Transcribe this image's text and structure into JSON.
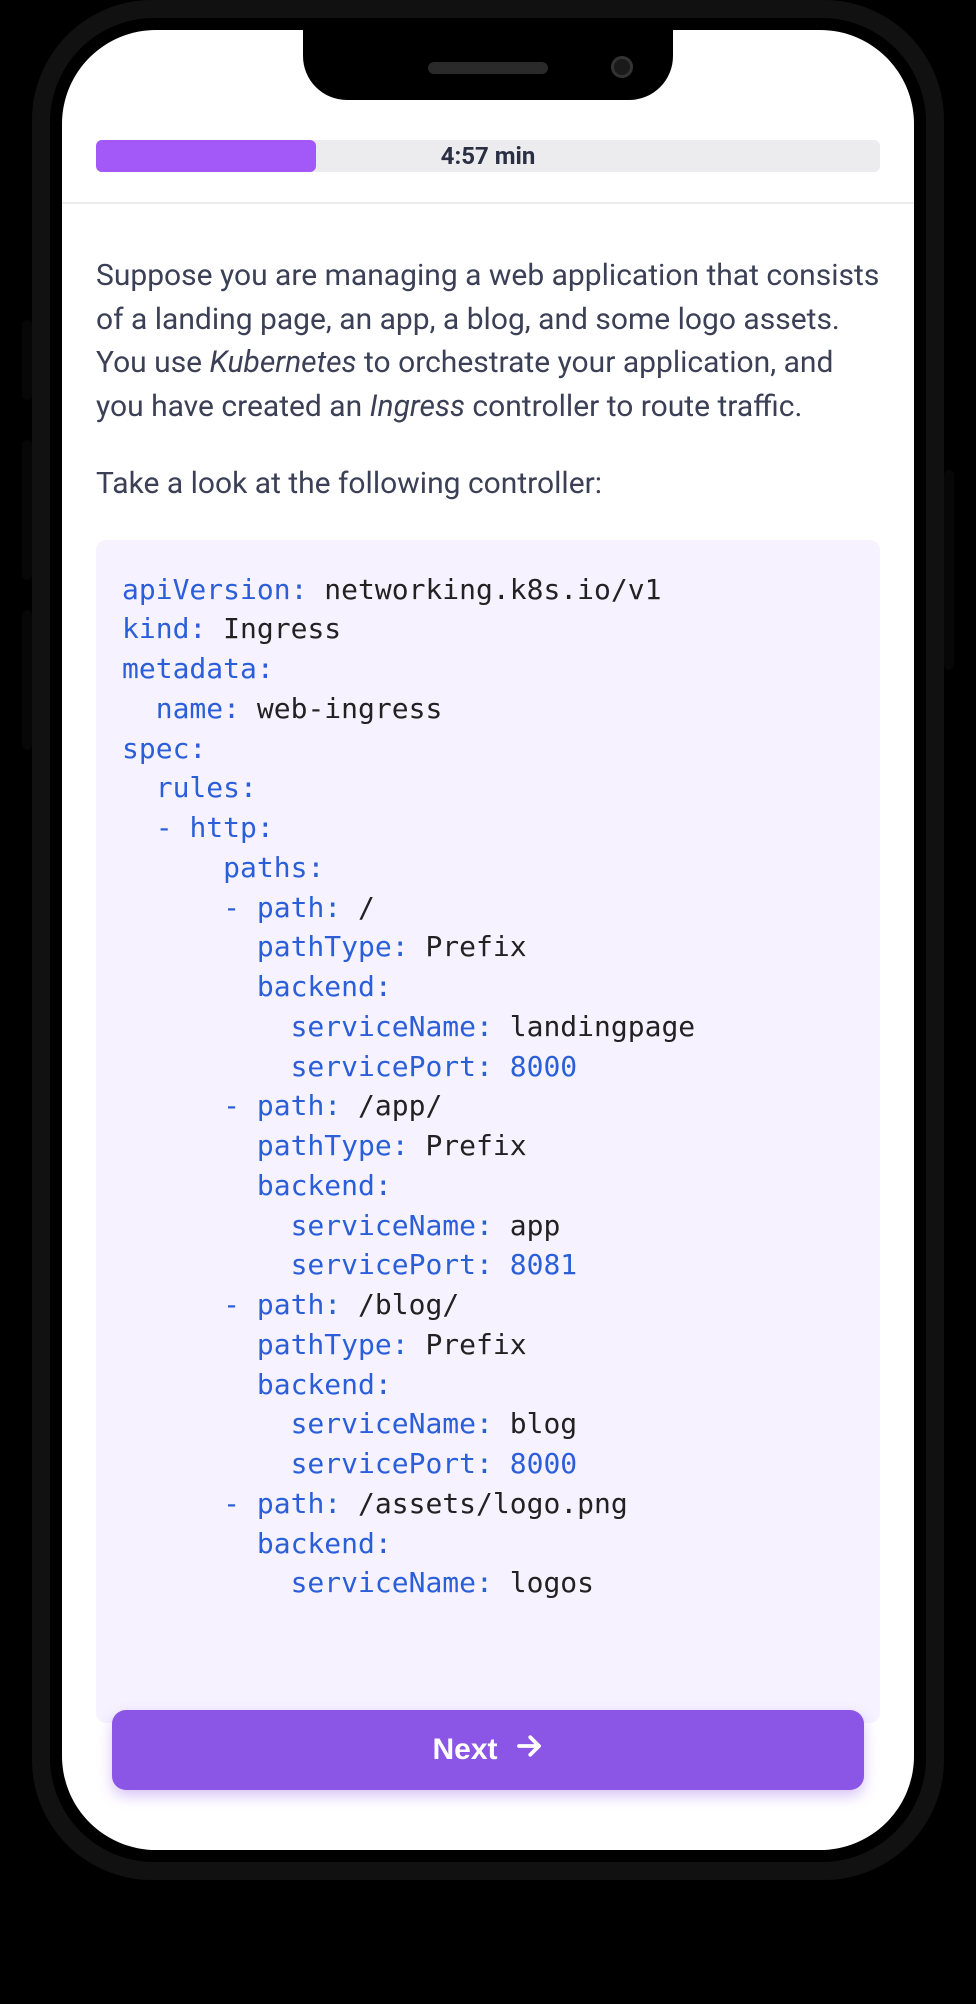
{
  "progress": {
    "percent": 28,
    "label": "4:57 min"
  },
  "intro": {
    "p1_a": "Suppose you are managing a web application that consists of a landing page, an app, a blog, and some logo assets. You use ",
    "p1_em1": "Kubernetes",
    "p1_b": " to orchestrate your application, and you have created an ",
    "p1_em2": "Ingress",
    "p1_c": " controller to route traffic.",
    "p2": "Take a look at the following controller:"
  },
  "yaml": {
    "apiVersion": "networking.k8s.io/v1",
    "kind": "Ingress",
    "metadata": {
      "name": "web-ingress"
    },
    "spec": {
      "rules": [
        {
          "http": {
            "paths": [
              {
                "path": "/",
                "pathType": "Prefix",
                "backend": {
                  "serviceName": "landingpage",
                  "servicePort": 8000
                }
              },
              {
                "path": "/app/",
                "pathType": "Prefix",
                "backend": {
                  "serviceName": "app",
                  "servicePort": 8081
                }
              },
              {
                "path": "/blog/",
                "pathType": "Prefix",
                "backend": {
                  "serviceName": "blog",
                  "servicePort": 8000
                }
              },
              {
                "path": "/assets/logo.png",
                "backend": {
                  "serviceName": "logos"
                }
              }
            ]
          }
        }
      ]
    }
  },
  "labels": {
    "apiVersion": "apiVersion:",
    "kind": "kind:",
    "metadata": "metadata:",
    "name": "name:",
    "spec": "spec:",
    "rules": "rules:",
    "http": "http:",
    "paths": "paths:",
    "path": "path:",
    "pathType": "pathType:",
    "backend": "backend:",
    "serviceName": "serviceName:",
    "servicePort": "servicePort:"
  },
  "button": {
    "next": "Next"
  },
  "colors": {
    "accent": "#8b55e6",
    "progressFill": "#a259f7",
    "codeBg": "#f6f2ff",
    "key": "#2b5fd9",
    "text": "#3b4056"
  }
}
